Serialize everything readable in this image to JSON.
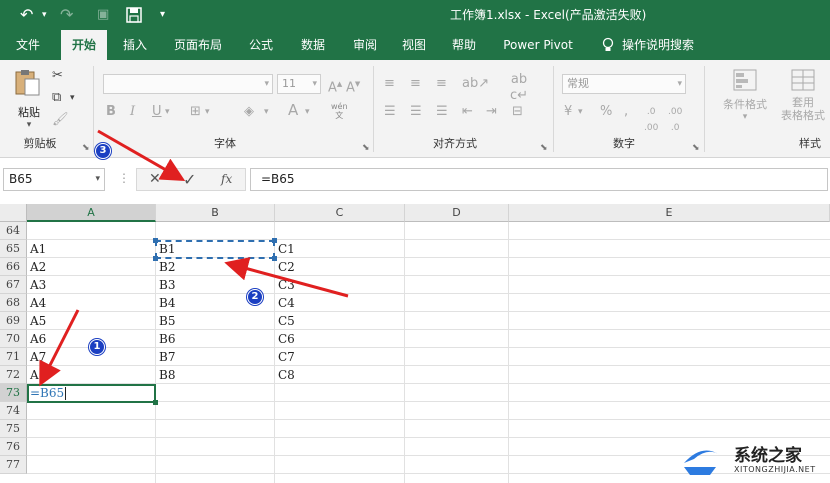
{
  "quickaccess": {
    "undo": "↶",
    "redo": "↷",
    "save": "💾",
    "more": "▾"
  },
  "window": {
    "title": "工作簿1.xlsx  -  Excel(产品激活失败)"
  },
  "tabs": [
    "文件",
    "开始",
    "插入",
    "页面布局",
    "公式",
    "数据",
    "审阅",
    "视图",
    "帮助",
    "Power Pivot"
  ],
  "tellme": "操作说明搜索",
  "ribbon": {
    "groups": {
      "clipboard": "剪贴板",
      "font": "字体",
      "align": "对齐方式",
      "number": "数字",
      "styles": "样式"
    },
    "paste_label": "粘贴",
    "font_size": "11",
    "number_format": "常规",
    "cond_format": "条件格式",
    "table_format_1": "套用",
    "table_format_2": "表格格式",
    "wen": "wén\n文"
  },
  "formula_bar": {
    "name_box": "B65",
    "formula": "=B65",
    "cancel": "✕",
    "enter": "✓",
    "fx": "fx"
  },
  "sheet": {
    "columns": [
      "A",
      "B",
      "C",
      "D",
      "E"
    ],
    "rows": [
      "64",
      "65",
      "66",
      "67",
      "68",
      "69",
      "70",
      "71",
      "72",
      "73",
      "74",
      "75",
      "76",
      "77"
    ],
    "col_a": [
      "A1",
      "A2",
      "A3",
      "A4",
      "A5",
      "A6",
      "A7",
      "A8"
    ],
    "col_b": [
      "B1",
      "B2",
      "B3",
      "B4",
      "B5",
      "B6",
      "B7",
      "B8"
    ],
    "col_c": [
      "C1",
      "C2",
      "C3",
      "C4",
      "C5",
      "C6",
      "C7",
      "C8"
    ],
    "editing_cell": "=B65"
  },
  "annotations": {
    "step1": "1",
    "step2": "2",
    "step3": "3",
    "arrow_color": "#e02020"
  },
  "watermark": {
    "name": "系统之家",
    "url": "XITONGZHIJIA.NET"
  },
  "colors": {
    "brand": "#217346",
    "selection": "#2f6fb0",
    "badge": "#1b3fc2"
  }
}
